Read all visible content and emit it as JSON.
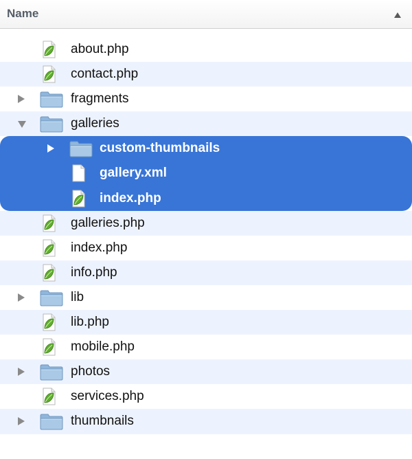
{
  "header": {
    "column_label": "Name",
    "sort_icon": "triangle-up-icon"
  },
  "colors": {
    "selection": "#3875d7",
    "alternate_row": "#edf3fe",
    "leaf_green": "#5fae2d",
    "folder_blue": "#a9c9e6"
  },
  "items": [
    {
      "name": "about.php",
      "type": "php",
      "indent": 1,
      "disclosure": "none",
      "selected": false
    },
    {
      "name": "contact.php",
      "type": "php",
      "indent": 1,
      "disclosure": "none",
      "selected": false
    },
    {
      "name": "fragments",
      "type": "folder",
      "indent": 1,
      "disclosure": "closed",
      "selected": false
    },
    {
      "name": "galleries",
      "type": "folder",
      "indent": 1,
      "disclosure": "open",
      "selected": false
    },
    {
      "name": "custom-thumbnails",
      "type": "folder",
      "indent": 2,
      "disclosure": "closed",
      "selected": true
    },
    {
      "name": "gallery.xml",
      "type": "file",
      "indent": 2,
      "disclosure": "none",
      "selected": true
    },
    {
      "name": "index.php",
      "type": "php",
      "indent": 2,
      "disclosure": "none",
      "selected": true
    },
    {
      "name": "galleries.php",
      "type": "php",
      "indent": 1,
      "disclosure": "none",
      "selected": false
    },
    {
      "name": "index.php",
      "type": "php",
      "indent": 1,
      "disclosure": "none",
      "selected": false
    },
    {
      "name": "info.php",
      "type": "php",
      "indent": 1,
      "disclosure": "none",
      "selected": false
    },
    {
      "name": "lib",
      "type": "folder",
      "indent": 1,
      "disclosure": "closed",
      "selected": false
    },
    {
      "name": "lib.php",
      "type": "php",
      "indent": 1,
      "disclosure": "none",
      "selected": false
    },
    {
      "name": "mobile.php",
      "type": "php",
      "indent": 1,
      "disclosure": "none",
      "selected": false
    },
    {
      "name": "photos",
      "type": "folder",
      "indent": 1,
      "disclosure": "closed",
      "selected": false
    },
    {
      "name": "services.php",
      "type": "php",
      "indent": 1,
      "disclosure": "none",
      "selected": false
    },
    {
      "name": "thumbnails",
      "type": "folder",
      "indent": 1,
      "disclosure": "closed",
      "selected": false
    }
  ]
}
